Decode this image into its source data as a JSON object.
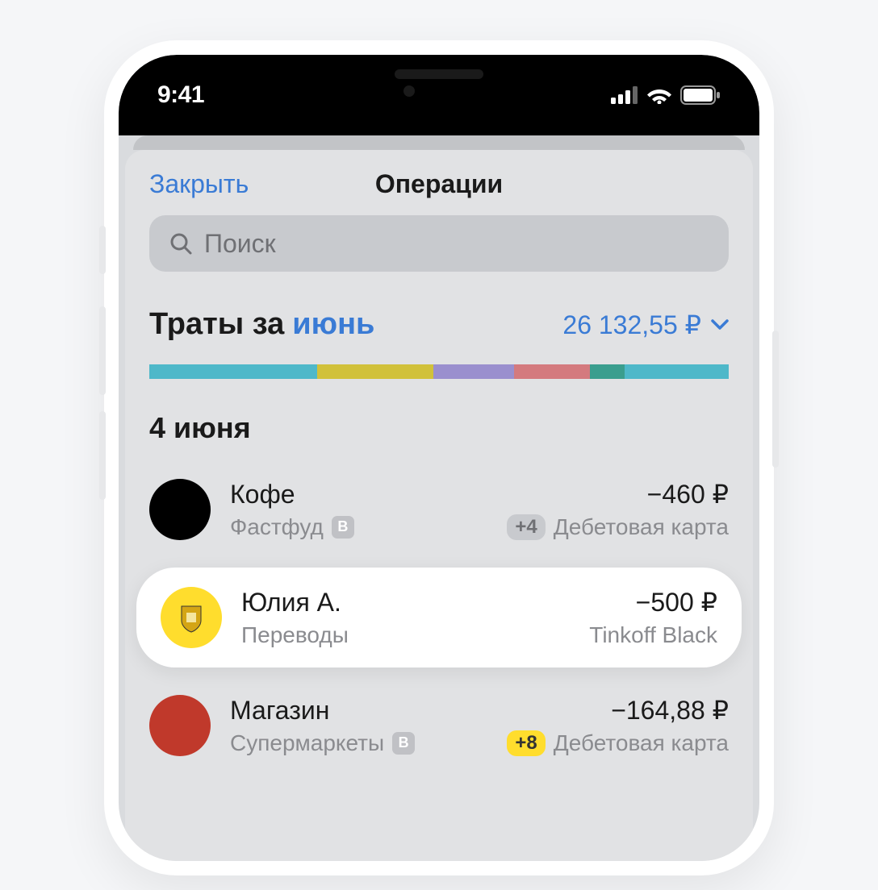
{
  "status": {
    "time": "9:41"
  },
  "nav": {
    "close": "Закрыть",
    "title": "Операции"
  },
  "search": {
    "placeholder": "Поиск"
  },
  "summary": {
    "prefix": "Траты за",
    "month": "июнь",
    "total": "26 132,55 ₽"
  },
  "chart_data": {
    "type": "bar",
    "segments": [
      {
        "color": "#4eb8c9",
        "pct": 29
      },
      {
        "color": "#d1c13a",
        "pct": 20
      },
      {
        "color": "#9a8fce",
        "pct": 14
      },
      {
        "color": "#d47a7e",
        "pct": 13
      },
      {
        "color": "#3a9e8e",
        "pct": 6
      },
      {
        "color": "#4eb8c9",
        "pct": 18
      }
    ]
  },
  "date_header": "4 июня",
  "transactions": [
    {
      "avatar_bg": "#000000",
      "avatar_type": "solid",
      "title": "Кофе",
      "subtitle": "Фастфуд",
      "sub_icon": "В",
      "amount": "−460 ₽",
      "source": "Дебетовая карта",
      "badge": "+4",
      "badge_style": "gray",
      "highlight": false
    },
    {
      "avatar_bg": "#ffdd2d",
      "avatar_type": "tinkoff",
      "title": "Юлия А.",
      "subtitle": "Переводы",
      "sub_icon": "",
      "amount": "−500 ₽",
      "source": "Tinkoff Black",
      "badge": "",
      "badge_style": "",
      "highlight": true
    },
    {
      "avatar_bg": "#c0392b",
      "avatar_type": "solid",
      "title": "Магазин",
      "subtitle": "Супермаркеты",
      "sub_icon": "В",
      "amount": "−164,88 ₽",
      "source": "Дебетовая карта",
      "badge": "+8",
      "badge_style": "yellow",
      "highlight": false
    }
  ]
}
